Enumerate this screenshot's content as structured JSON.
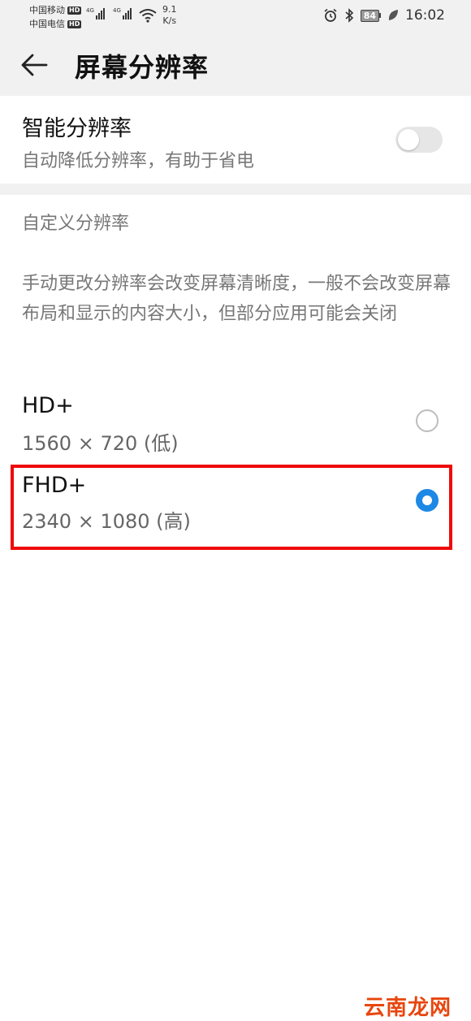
{
  "status_bar": {
    "carrier1": "中国移动",
    "carrier2": "中国电信",
    "hd_badge": "HD",
    "net_tag": "4G",
    "speed_value": "9.1",
    "speed_unit": "K/s",
    "battery_level": "84",
    "time": "16:02"
  },
  "header": {
    "title": "屏幕分辨率"
  },
  "smart_resolution": {
    "title": "智能分辨率",
    "subtitle": "自动降低分辨率，有助于省电",
    "enabled": false
  },
  "custom_section": {
    "header": "自定义分辨率",
    "description": "手动更改分辨率会改变屏幕清晰度，一般不会改变屏幕布局和显示的内容大小，但部分应用可能会关闭"
  },
  "options": [
    {
      "title": "HD+",
      "subtitle": "1560 × 720 (低)",
      "selected": false
    },
    {
      "title": "FHD+",
      "subtitle": "2340 × 1080 (高)",
      "selected": true
    }
  ],
  "watermark": {
    "text": "云南龙网"
  },
  "colors": {
    "accent": "#1e88e5",
    "highlight": "#ee0a0a",
    "background_band": "#f1f1f1",
    "watermark": "#e8460e"
  }
}
